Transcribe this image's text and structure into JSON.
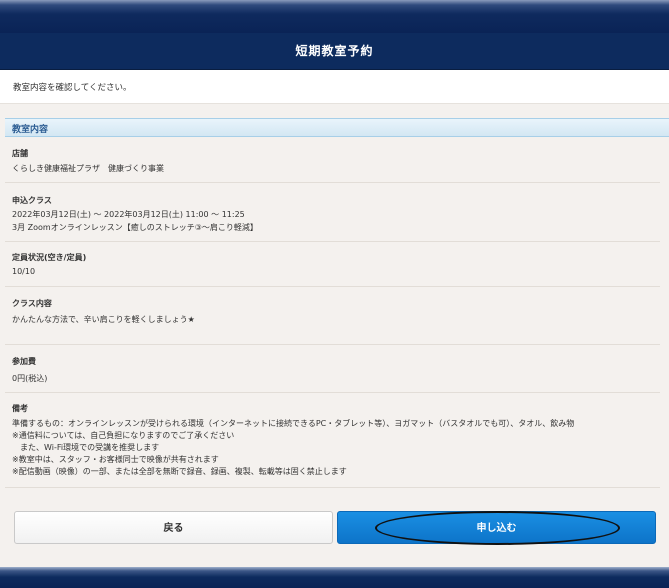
{
  "header": {
    "title": "短期教室予約"
  },
  "intro": {
    "text": "教室内容を確認してください。"
  },
  "section": {
    "title": "教室内容"
  },
  "fields": {
    "store": {
      "label": "店舗",
      "value": "くらしき健康福祉プラザ　健康づくり事業"
    },
    "class": {
      "label": "申込クラス",
      "line1": "2022年03月12日(土) ～ 2022年03月12日(土) 11:00 ～ 11:25",
      "line2": "3月 Zoomオンラインレッスン【癒しのストレッチ③～肩こり軽減】"
    },
    "capacity": {
      "label": "定員状況(空き/定員)",
      "value": "10/10"
    },
    "content": {
      "label": "クラス内容",
      "value": "かんたんな方法で、辛い肩こりを軽くしましょう★"
    },
    "fee": {
      "label": "参加費",
      "value": "0円(税込)"
    },
    "notes": {
      "label": "備考",
      "lines": [
        "準備するもの：オンラインレッスンが受けられる環境（インターネットに接続できるPC・タブレット等）、ヨガマット（バスタオルでも可）、タオル、飲み物",
        "※通信料については、自己負担になりますのでご了承ください",
        "　また、Wi-Fi環境での受講を推奨します",
        "※教室中は、スタッフ・お客様同士で映像が共有されます",
        "※配信動画（映像）の一部、または全部を無断で録音、録画、複製、転載等は固く禁止します"
      ]
    }
  },
  "buttons": {
    "back": "戻る",
    "apply": "申し込む"
  },
  "colors": {
    "header": "#0d2b5e",
    "apply": "#1180d6",
    "section_head": "#2c5d93"
  }
}
